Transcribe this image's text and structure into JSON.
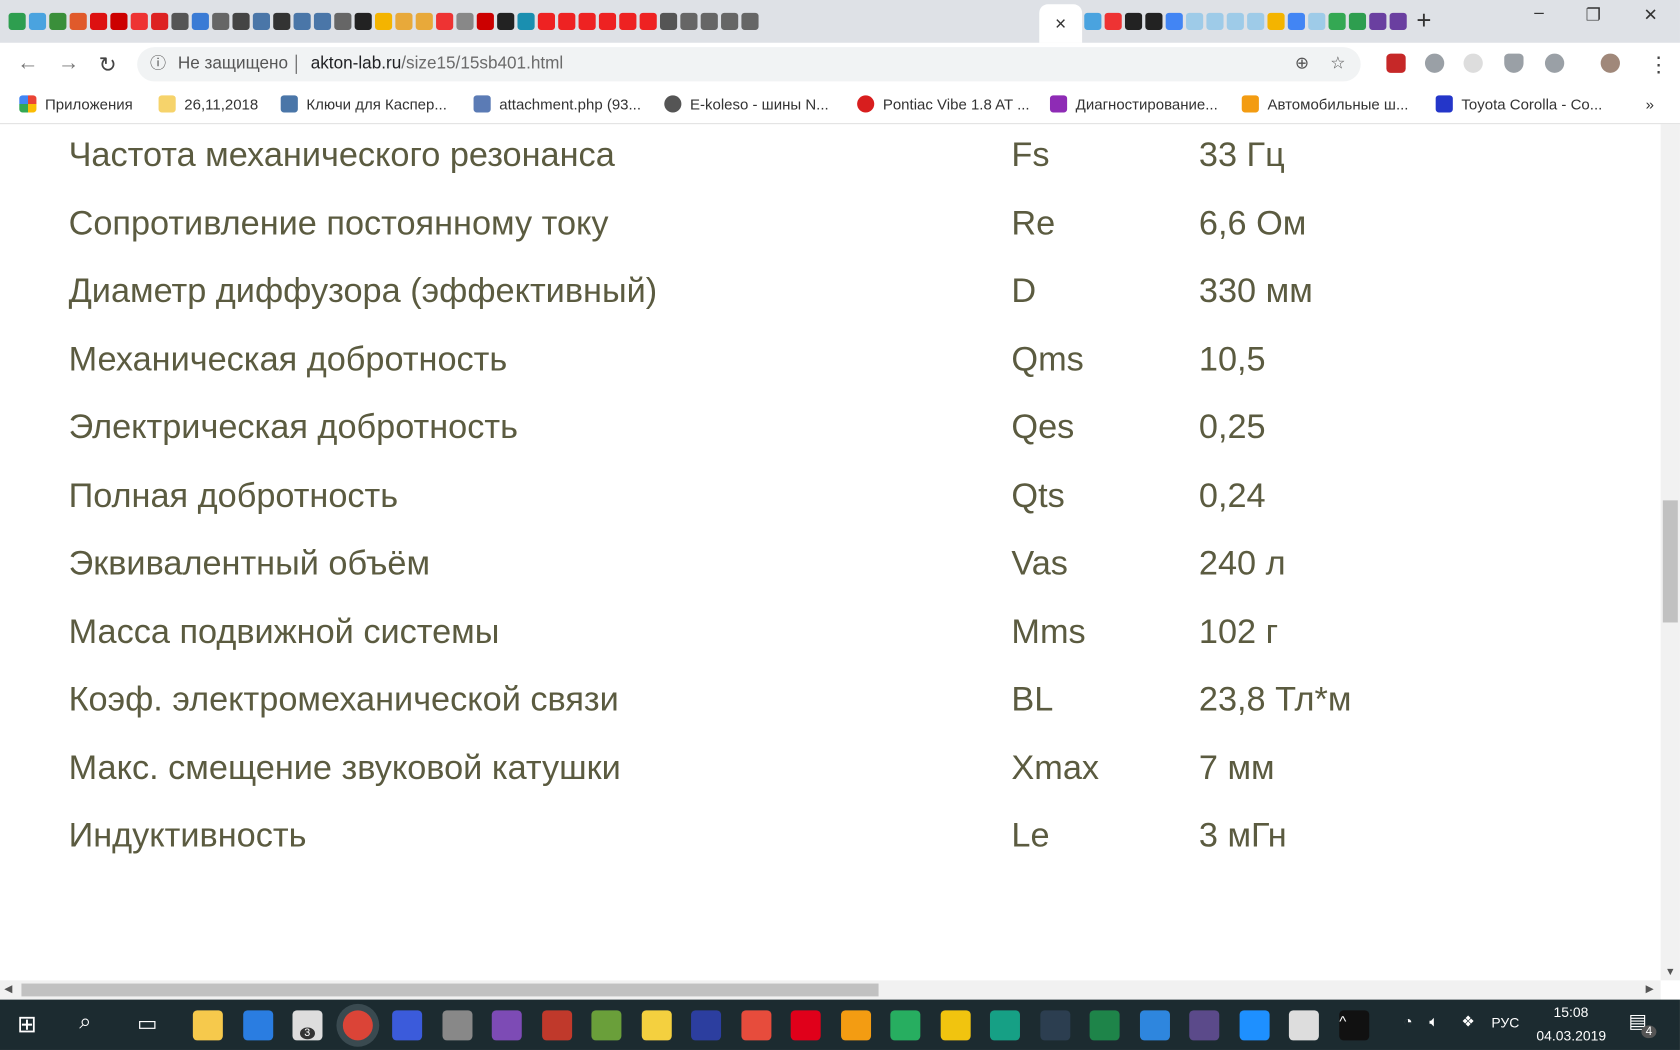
{
  "browser": {
    "active_tab_close": "×",
    "new_tab": "+",
    "window_controls": [
      "–",
      "❐",
      "✕"
    ],
    "address": {
      "security_label": "Не защищено",
      "url_host": "akton-lab.ru",
      "url_path": "/size15/15sb401.html"
    },
    "bookmarks": [
      {
        "label": "Приложения",
        "color": "#ea4335"
      },
      {
        "label": "26,11,2018",
        "color": "#f6d36b"
      },
      {
        "label": "Ключи для Каспер...",
        "color": "#4a76a8"
      },
      {
        "label": "attachment.php (93...",
        "color": "#5b7bb5"
      },
      {
        "label": "E-koleso - шины N...",
        "color": "#555555"
      },
      {
        "label": "Pontiac Vibe 1.8 AT ...",
        "color": "#d81e1e"
      },
      {
        "label": "Диагностирование...",
        "color": "#8e2bb5"
      },
      {
        "label": "Автомобильные ш...",
        "color": "#f39c12"
      },
      {
        "label": "Toyota Corolla - Co...",
        "color": "#2436c9"
      }
    ],
    "bookmarks_more": "»"
  },
  "specs": [
    {
      "name": "Частота механического резонанса",
      "symbol": "Fs",
      "value": "33 Гц"
    },
    {
      "name": "Сопротивление постоянному току",
      "symbol": "Re",
      "value": "6,6 Ом"
    },
    {
      "name": "Диаметр диффузора (эффективный)",
      "symbol": "D",
      "value": "330 мм"
    },
    {
      "name": "Механическая добротность",
      "symbol": "Qms",
      "value": "10,5"
    },
    {
      "name": "Электрическая добротность",
      "symbol": "Qes",
      "value": "0,25"
    },
    {
      "name": "Полная добротность",
      "symbol": "Qts",
      "value": "0,24"
    },
    {
      "name": "Эквивалентный объём",
      "symbol": "Vas",
      "value": "240 л"
    },
    {
      "name": "Масса подвижной системы",
      "symbol": "Mms",
      "value": "102 г"
    },
    {
      "name": "Коэф. электромеханической связи",
      "symbol": "BL",
      "value": "23,8 Тл*м"
    },
    {
      "name": "Макс. смещение звуковой катушки",
      "symbol": "Xmax",
      "value": "7 мм"
    },
    {
      "name": "Индуктивность",
      "symbol": "Le",
      "value": "3 мГн"
    }
  ],
  "taskbar": {
    "mail_badge": "3",
    "language": "РУС",
    "time": "15:08",
    "date": "04.03.2019",
    "notifications": "4"
  }
}
